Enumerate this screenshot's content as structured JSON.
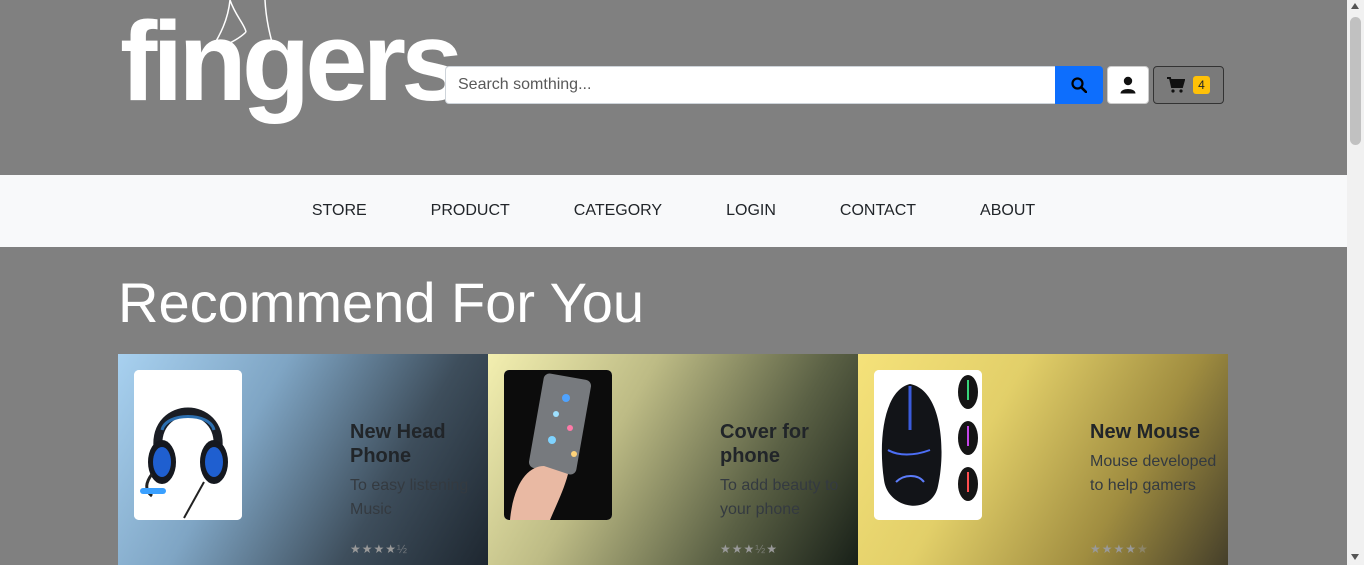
{
  "header": {
    "logo_text": "fingers",
    "search": {
      "placeholder": "Search somthing...",
      "value": ""
    },
    "icons": {
      "search": "search-icon",
      "user": "user-icon",
      "cart": "cart-icon"
    },
    "cart_count": "4"
  },
  "nav": {
    "items": [
      {
        "label": "STORE"
      },
      {
        "label": "PRODUCT"
      },
      {
        "label": "CATEGORY"
      },
      {
        "label": "LOGIN"
      },
      {
        "label": "CONTACT"
      },
      {
        "label": "ABOUT"
      }
    ]
  },
  "main": {
    "section_title": "Recommend For You",
    "cards": [
      {
        "title": "New Head Phone",
        "desc": "To easy listening Music",
        "image": "headphone-image",
        "rating": 4.5
      },
      {
        "title": "Cover for phone",
        "desc": "To add beauty to your phone",
        "image": "phone-cover-image",
        "rating": 3.5
      },
      {
        "title": "New Mouse",
        "desc": "Mouse developed to help gamers",
        "image": "gaming-mouse-image",
        "rating": 4
      }
    ]
  },
  "colors": {
    "background": "#808080",
    "navbar": "#f8f9fa",
    "primary": "#0d6efd",
    "badge": "#ffc107"
  }
}
